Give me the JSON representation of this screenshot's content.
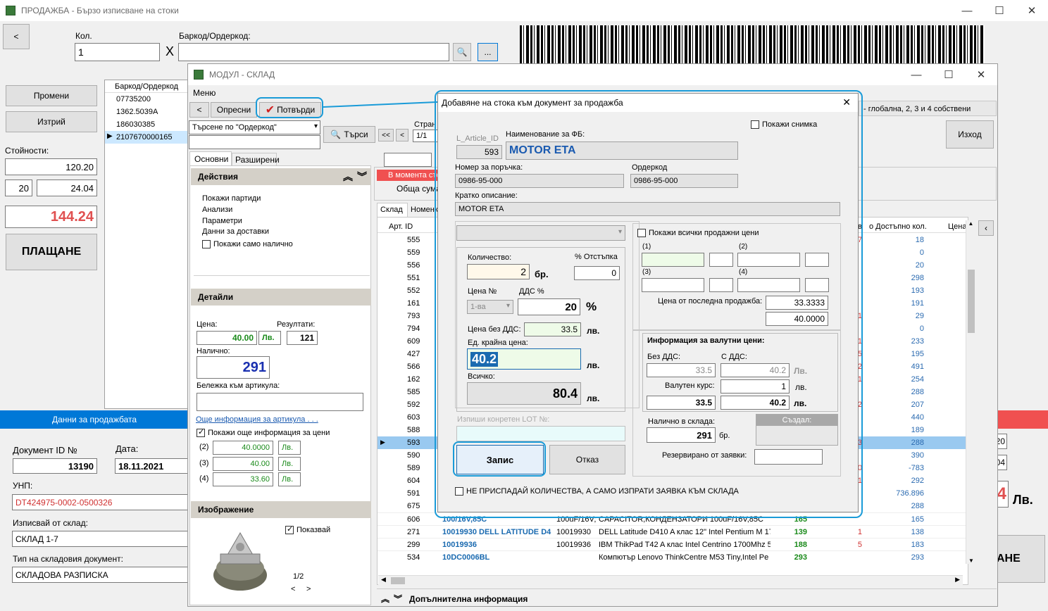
{
  "main": {
    "title": "ПРОДАЖБА - Бързо изписване на стоки",
    "back": "<",
    "qty_label": "Кол.",
    "qty_value": "1",
    "x": "X",
    "barcode_label": "Баркод/Ордеркод:",
    "barcode_value": "",
    "dots": "...",
    "btn_edit": "Промени",
    "btn_delete": "Изтрий",
    "values_label": "Стойности:",
    "v1": "120.20",
    "v_vat": "20",
    "v2": "24.04",
    "total": "144.24",
    "pay": "ПЛАЩАНЕ",
    "barcode_col": "Баркод/Ордеркод",
    "barcodes": [
      "07735200",
      "1362.5039A",
      "186030385",
      "2107670000165"
    ],
    "data_bar": "Данни за продажбата",
    "doc_id_label": "Документ ID №",
    "doc_id": "13190",
    "date_label": "Дата:",
    "date": "18.11.2021",
    "unp_label": "УНП:",
    "unp": "DT424975-0002-0500326",
    "from_wh_label": "Изписвай от склад:",
    "from_wh": "СКЛАД 1-7",
    "doc_type_label": "Тип на складовия документ:",
    "doc_type": "СКЛАДОВА РАЗПИСКА",
    "right_total_tail": "4",
    "right_currency": "Лв.",
    "right_pay_tail": "АНЕ",
    "right_box1": "20",
    "right_box2": "04"
  },
  "wh": {
    "title": "МОДУЛ - СКЛАД",
    "menu": "Меню",
    "back": "<",
    "refresh": "Опресни",
    "confirm": "Потвърди",
    "search_mode": "Търсене по \"Ордеркод\"",
    "search_btn": "Търси",
    "nav_first": "<<",
    "nav_prev": "<",
    "page_label": "Стран",
    "page": "1/1",
    "tab_basic": "Основни",
    "tab_ext": "Разширени",
    "actions_title": "Действия",
    "actions": [
      "Покажи партиди",
      "Анализи",
      "Параметри",
      "Данни за доставки"
    ],
    "only_available": "Покажи само налично",
    "details_title": "Детайли",
    "price_label": "Цена:",
    "price": "40.00",
    "currency": "Лв.",
    "results_label": "Резултати:",
    "results": "121",
    "available_label": "Налично:",
    "available": "291",
    "note_label": "Бележка към артикула:",
    "more_info_link": "Още информация за артикула . . .",
    "more_prices": "Покажи още информация за цени",
    "prices": [
      {
        "n": "(2)",
        "v": "40.0000",
        "c": "Лв."
      },
      {
        "n": "(3)",
        "v": "40.00",
        "c": "Лв."
      },
      {
        "n": "(4)",
        "v": "33.60",
        "c": "Лв."
      }
    ],
    "image_title": "Изображение",
    "show_image": "Показвай",
    "img_page": "1/2",
    "img_prev": "<",
    "img_next": ">",
    "pricing_info": "- глобална, 2, 3 и 4 собствени",
    "exit": "Изход",
    "moment_red": "В момента сто",
    "sum_label": "Обща сума",
    "tab_wh": "Склад",
    "tab_nom": "Номенк",
    "col_id": "Арт. ID",
    "col_c": "в",
    "col_avail": "о Достъпно кол.",
    "col_price": "Цена",
    "footer": "Допълнителна информация",
    "rows": [
      {
        "id": "555",
        "c": "7",
        "a": "18"
      },
      {
        "id": "559",
        "c": "",
        "a": "0"
      },
      {
        "id": "556",
        "c": "",
        "a": "20"
      },
      {
        "id": "551",
        "c": "",
        "a": "298"
      },
      {
        "id": "552",
        "c": "",
        "a": "193"
      },
      {
        "id": "161",
        "c": "",
        "a": "191"
      },
      {
        "id": "793",
        "c": "1",
        "a": "29"
      },
      {
        "id": "794",
        "c": "",
        "a": "0"
      },
      {
        "id": "609",
        "c": "1",
        "a": "233"
      },
      {
        "id": "427",
        "c": "5",
        "a": "195"
      },
      {
        "id": "566",
        "c": "2",
        "a": "491"
      },
      {
        "id": "162",
        "c": "1",
        "a": "254"
      },
      {
        "id": "585",
        "c": "",
        "a": "288"
      },
      {
        "id": "592",
        "c": "52",
        "a": "207"
      },
      {
        "id": "603",
        "c": "",
        "a": "440"
      },
      {
        "id": "588",
        "c": "",
        "a": "189"
      },
      {
        "id": "593",
        "c": "3",
        "a": "288"
      },
      {
        "id": "590",
        "c": "",
        "a": "390"
      },
      {
        "id": "589",
        "c": "30",
        "a": "-783"
      },
      {
        "id": "604",
        "c": "1",
        "a": "292"
      },
      {
        "id": "591",
        "c": "",
        "a": "736.896"
      },
      {
        "id": "675",
        "c": "",
        "a": "288"
      }
    ],
    "rows_full": [
      {
        "id": "606",
        "code": "100/16V,85C",
        "order": "100uF/16V;",
        "name": "CAPACITOR,КОНДЕНЗАТОРИ 100uF/16V,85C",
        "q": "165",
        "c": "",
        "a": "165"
      },
      {
        "id": "271",
        "code": "10019930 DELL LATITUDE D4",
        "order": "10019930",
        "name": "DELL Latitude D410 A клас 12\" Intel Pentium M 17",
        "q": "139",
        "c": "1",
        "a": "138"
      },
      {
        "id": "299",
        "code": "10019936",
        "order": "10019936",
        "name": "IBM ThikPad T42 A клас Intel Centrino 1700Mhz 5",
        "q": "188",
        "c": "5",
        "a": "183"
      },
      {
        "id": "534",
        "code": "10DC0006BL",
        "order": "",
        "name": "Компютър Lenovo ThinkCentre M53 Tiny,Intel Pe",
        "q": "293",
        "c": "",
        "a": "293"
      }
    ]
  },
  "dlg": {
    "title": "Добавяне на стока към документ за продажба",
    "close": "✕",
    "article_id_label": "L_Article_ID",
    "article_id": "593",
    "name_label": "Наименование за ФБ:",
    "name": "MOTOR ETA",
    "show_photo": "Покажи снимка",
    "order_no_label": "Номер за поръчка:",
    "order_no": "0986-95-000",
    "ordercode_label": "Ордеркод",
    "ordercode": "0986-95-000",
    "desc_label": "Кратко описание:",
    "desc": "MOTOR ETA",
    "qty_label": "Количество:",
    "qty": "2",
    "pcs": "бр.",
    "discount_label": "% Отстъпка",
    "discount": "0",
    "price_no_label": "Цена №",
    "price_no": "1-ва",
    "vat_label": "ДДС %",
    "vat": "20",
    "pct": "%",
    "net_label": "Цена без ДДС:",
    "net": "33.5",
    "lv": "лв.",
    "unit_label": "Ед. крайна цена:",
    "unit": "40.2",
    "total_label": "Всичко:",
    "total": "80.4",
    "lot_label": "Изпиши конретен LOT №:",
    "save": "Запис",
    "cancel": "Отказ",
    "show_all_prices": "Покажи всички продажни цени",
    "p1": "(1)",
    "p2": "(2)",
    "p3": "(3)",
    "p4": "(4)",
    "last_sale_label": "Цена от последна продажба:",
    "last_sale1": "33.3333",
    "last_sale2": "40.0000",
    "fx_title": "Информация за валутни цени:",
    "fx_no_vat": "Без ДДС:",
    "fx_with_vat": "С ДДС:",
    "fx_net": "33.5",
    "fx_gross": "40.2",
    "fx_cur": "Лв.",
    "fx_rate_label": "Валутен курс:",
    "fx_rate": "1",
    "fx_lv": "лв.",
    "fx_net2": "33.5",
    "fx_gross2": "40.2",
    "fx_lv2": "лв.",
    "stock_label": "Налично в склада:",
    "stock": "291",
    "stock_pcs": "бр.",
    "created": "Създал:",
    "reserved_label": "Резервирано от заявки:",
    "no_add": "НЕ ПРИСПАДАЙ КОЛИЧЕСТВА, А САМО ИЗПРАТИ ЗАЯВКА КЪМ СКЛАДА"
  },
  "colors": {
    "accent": "#1a9bd8",
    "blue_bar": "#0078d7",
    "red_bar": "#f05050",
    "total_red": "#e05050"
  }
}
